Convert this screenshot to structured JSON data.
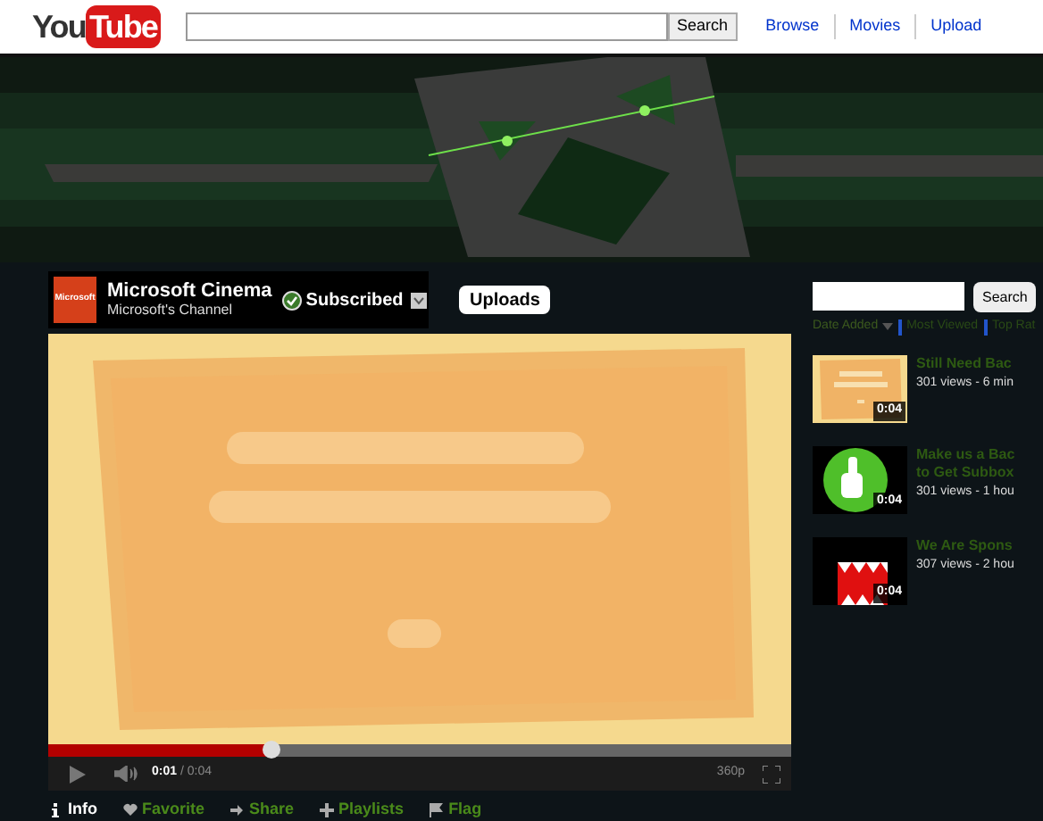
{
  "header": {
    "logo": [
      "You",
      "Tube"
    ],
    "search_button": "Search",
    "links": [
      "Browse",
      "Movies",
      "Upload"
    ]
  },
  "channel": {
    "logo_text": "Microsoft",
    "name": "Microsoft Cinema",
    "subtitle": "Microsoft's Channel",
    "subscribed": true,
    "subscribe_label": "Subscribed",
    "tab": "Uploads"
  },
  "player": {
    "level": 0.3,
    "time_current": "0:01",
    "time_total": "/ 0:04",
    "quality": "360p"
  },
  "actions": [
    {
      "label": "Info",
      "selected": true
    },
    {
      "label": "Favorite",
      "selected": false
    },
    {
      "label": "Share",
      "selected": false
    },
    {
      "label": "Playlists",
      "selected": false
    },
    {
      "label": "Flag",
      "selected": false
    }
  ],
  "sidebar": {
    "search_button": "Search",
    "sort": [
      {
        "label": "Date Added",
        "selected": true
      },
      {
        "label": "Most Viewed",
        "selected": false
      },
      {
        "label": "Top Rat",
        "selected": false
      }
    ],
    "videos": [
      {
        "title": [
          "Still Need Bac"
        ],
        "meta": "301 views - 6 min",
        "duration": "0:04"
      },
      {
        "title": [
          "Make us a Bac",
          "to Get Subbox"
        ],
        "meta": "301 views - 1 hou",
        "duration": "0:04"
      },
      {
        "title": [
          "We Are Spons"
        ],
        "meta": "307 views - 2 hou",
        "duration": "0:04"
      }
    ]
  }
}
